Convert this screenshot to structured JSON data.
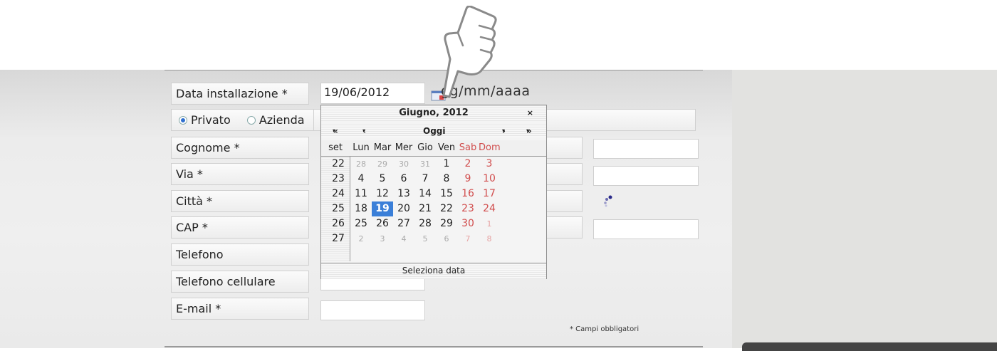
{
  "form": {
    "date_label": "Data installazione *",
    "date_value": "19/06/2012",
    "date_hint": "gg/mm/aaaa",
    "radio_private": "Privato",
    "radio_company": "Azienda",
    "fields": [
      "Cognome *",
      "Via *",
      "Città *",
      "CAP *",
      "Telefono",
      "Telefono cellulare",
      "E-mail *"
    ],
    "required_note": "* Campi obbligatori"
  },
  "calendar": {
    "title": "Giugno, 2012",
    "close": "×",
    "nav_prev_year": "«",
    "nav_prev_month": "‹",
    "nav_today": "Oggi",
    "nav_next_month": "›",
    "nav_next_year": "»",
    "week_header": "set",
    "day_headers": [
      "Lun",
      "Mar",
      "Mer",
      "Gio",
      "Ven",
      "Sab",
      "Dom"
    ],
    "weeks": [
      {
        "n": "22",
        "days": [
          "28",
          "29",
          "30",
          "31",
          "1",
          "2",
          "3"
        ]
      },
      {
        "n": "23",
        "days": [
          "4",
          "5",
          "6",
          "7",
          "8",
          "9",
          "10"
        ]
      },
      {
        "n": "24",
        "days": [
          "11",
          "12",
          "13",
          "14",
          "15",
          "16",
          "17"
        ]
      },
      {
        "n": "25",
        "days": [
          "18",
          "19",
          "20",
          "21",
          "22",
          "23",
          "24"
        ]
      },
      {
        "n": "26",
        "days": [
          "25",
          "26",
          "27",
          "28",
          "29",
          "30",
          "1"
        ]
      },
      {
        "n": "27",
        "days": [
          "2",
          "3",
          "4",
          "5",
          "6",
          "7",
          "8"
        ]
      }
    ],
    "selected_day": "19",
    "footer": "Seleziona data"
  },
  "colors": {
    "accent": "#3a7fd8",
    "weekend": "#d14d4d"
  },
  "icons": [
    "calendar-icon",
    "pointing-hand-icon",
    "radio-icon"
  ]
}
